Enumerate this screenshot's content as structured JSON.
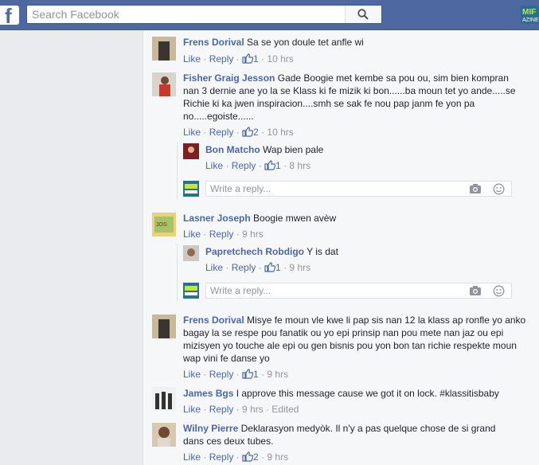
{
  "header": {
    "logo_letter": "f",
    "search_placeholder": "Search Facebook",
    "brand_logo": "MIF AZINE"
  },
  "labels": {
    "like": "Like",
    "reply": "Reply",
    "reply_placeholder": "Write a reply..."
  },
  "comments": [
    {
      "name": "Frens Dorival",
      "text": "Sa se yon doule tet anfle wi",
      "likes": "1",
      "time": "10 hrs"
    },
    {
      "name": "Fisher Graig Jesson",
      "text": "Gade Boogie met kembe sa pou ou, sim bien kompran nan 3 dernie ane yo la se Klass ki fe mizik ki bon......ba moun tet yo ande.....se Richie ki ka jwen inspiracion....smh se sak fe nou pap janm fe yon pa no.....egoiste......",
      "likes": "2",
      "time": "10 hrs",
      "replies": [
        {
          "name": "Bon Matcho",
          "text": "Wap bien pale",
          "likes": "1",
          "time": "8 hrs"
        }
      ]
    },
    {
      "name": "Lasner Joseph",
      "text": "Boogie mwen avèw",
      "time": "9 hrs",
      "replies": [
        {
          "name": "Papretchech Robdigo",
          "text": "Y is dat",
          "likes": "1",
          "time": "9 hrs"
        }
      ]
    },
    {
      "name": "Frens Dorival",
      "text": "Misye fe moun vle kwe li pap sis nan 12 la klass ap ronfle yo anko bagay la se respe pou fanatik ou yo epi prinsip nan pou mete nan jaz ou epi mizisyen yo touche ale epi ou gen bisnis pou yon bon tan richie respekte moun wap vini fe danse yo",
      "likes": "1",
      "time": "9 hrs"
    },
    {
      "name": "James Bgs",
      "text": "I approve this message cause we got it on lock. #klassitisbaby",
      "time": "9 hrs",
      "edited": "Edited"
    },
    {
      "name": "Wilny Pierre",
      "text": "Deklarasyon medyòk. Il n'y a pas quelque chose de si grand dans ces deux tubes.",
      "likes": "2",
      "time": "9 hrs"
    }
  ],
  "colors": {
    "topbar": "#4e69a2",
    "link": "#4b67a1",
    "meta": "#90949c",
    "panel": "#f6f7f9"
  },
  "icons": [
    "search-icon",
    "thumbs-up-icon",
    "camera-icon",
    "smiley-icon"
  ]
}
